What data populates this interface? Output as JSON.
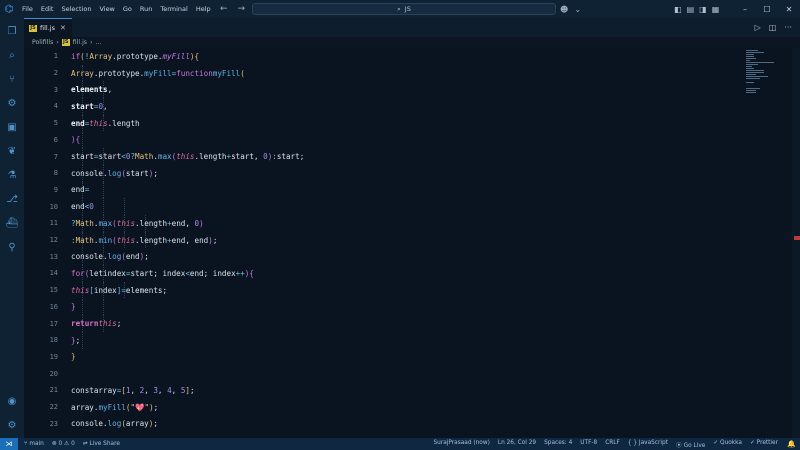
{
  "titlebar": {
    "menu": [
      "File",
      "Edit",
      "Selection",
      "View",
      "Go",
      "Run",
      "Terminal",
      "Help"
    ],
    "search_text": "JS",
    "search_icon": "search-icon"
  },
  "tabs": [
    {
      "label": "fill.js",
      "badge": "JS"
    }
  ],
  "breadcrumb": {
    "folder": "Polifills",
    "file": "fill.js",
    "more": "..."
  },
  "editor": {
    "line_numbers": [
      "1",
      "2",
      "3",
      "4",
      "5",
      "6",
      "7",
      "8",
      "9",
      "10",
      "11",
      "12",
      "13",
      "14",
      "15",
      "16",
      "17",
      "18",
      "19",
      "20",
      "21",
      "22",
      "23"
    ]
  },
  "statusbar": {
    "branch": "main",
    "problems": "0 ⚠ 0",
    "live_share": "Live Share",
    "author": "SurajPrasaad (now)",
    "position": "Ln 26, Col 29",
    "spaces": "Spaces: 4",
    "encoding": "UTF-8",
    "eol": "CRLF",
    "language": "JavaScript",
    "go_live": "Go Live",
    "quokka": "Quokka",
    "prettier": "Prettier"
  },
  "colors": {
    "background": "#0a1421",
    "accent": "#3a8fd6",
    "keyword": "#c678dd",
    "function": "#5fb3e4",
    "number": "#a48de6"
  }
}
